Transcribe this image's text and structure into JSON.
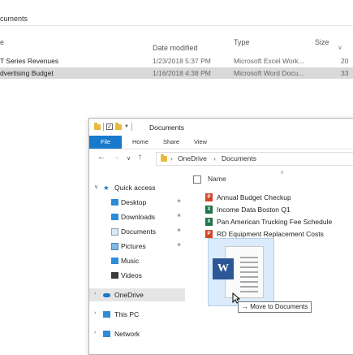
{
  "background": {
    "title_fragment": "cuments",
    "columns": {
      "name": "e",
      "date_modified": "Date modified",
      "type": "Type",
      "size": "Size"
    },
    "rows": [
      {
        "name": "T Series Revenues",
        "date": "1/23/2018 5:37 PM",
        "type": "Microsoft Excel Work...",
        "size": "20",
        "selected": false
      },
      {
        "name": "dvertising Budget",
        "date": "1/16/2018 4:38 PM",
        "type": "Microsoft Word Docu...",
        "size": "33",
        "selected": true
      }
    ]
  },
  "window": {
    "title": "Documents",
    "ribbon_tabs": [
      "File",
      "Home",
      "Share",
      "View"
    ],
    "breadcrumb": [
      "OneDrive",
      "Documents"
    ],
    "nav": {
      "quick_access": "Quick access",
      "items": [
        "Desktop",
        "Downloads",
        "Documents",
        "Pictures",
        "Music",
        "Videos"
      ],
      "onedrive": "OneDrive",
      "this_pc": "This PC",
      "network": "Network"
    },
    "column_name": "Name",
    "files": [
      {
        "name": "Annual Budget Checkup",
        "icon": "powerpoint-file-icon",
        "color": "#d24726"
      },
      {
        "name": "Income Data Boston Q1",
        "icon": "excel-file-icon",
        "color": "#217346"
      },
      {
        "name": "Pan American Trucking Fee Schedule",
        "icon": "excel-file-icon",
        "color": "#217346"
      },
      {
        "name": "RD Equipment Replacement Costs",
        "icon": "powerpoint-file-icon",
        "color": "#d24726"
      }
    ],
    "drag": {
      "doc_letter": "W",
      "tooltip_arrow": "→",
      "tooltip_text": "Move to Documents"
    }
  },
  "colors": {
    "accent": "#1979ca",
    "word": "#2b5797",
    "folder": "#e8b93d",
    "selection": "#d9d9d9"
  }
}
